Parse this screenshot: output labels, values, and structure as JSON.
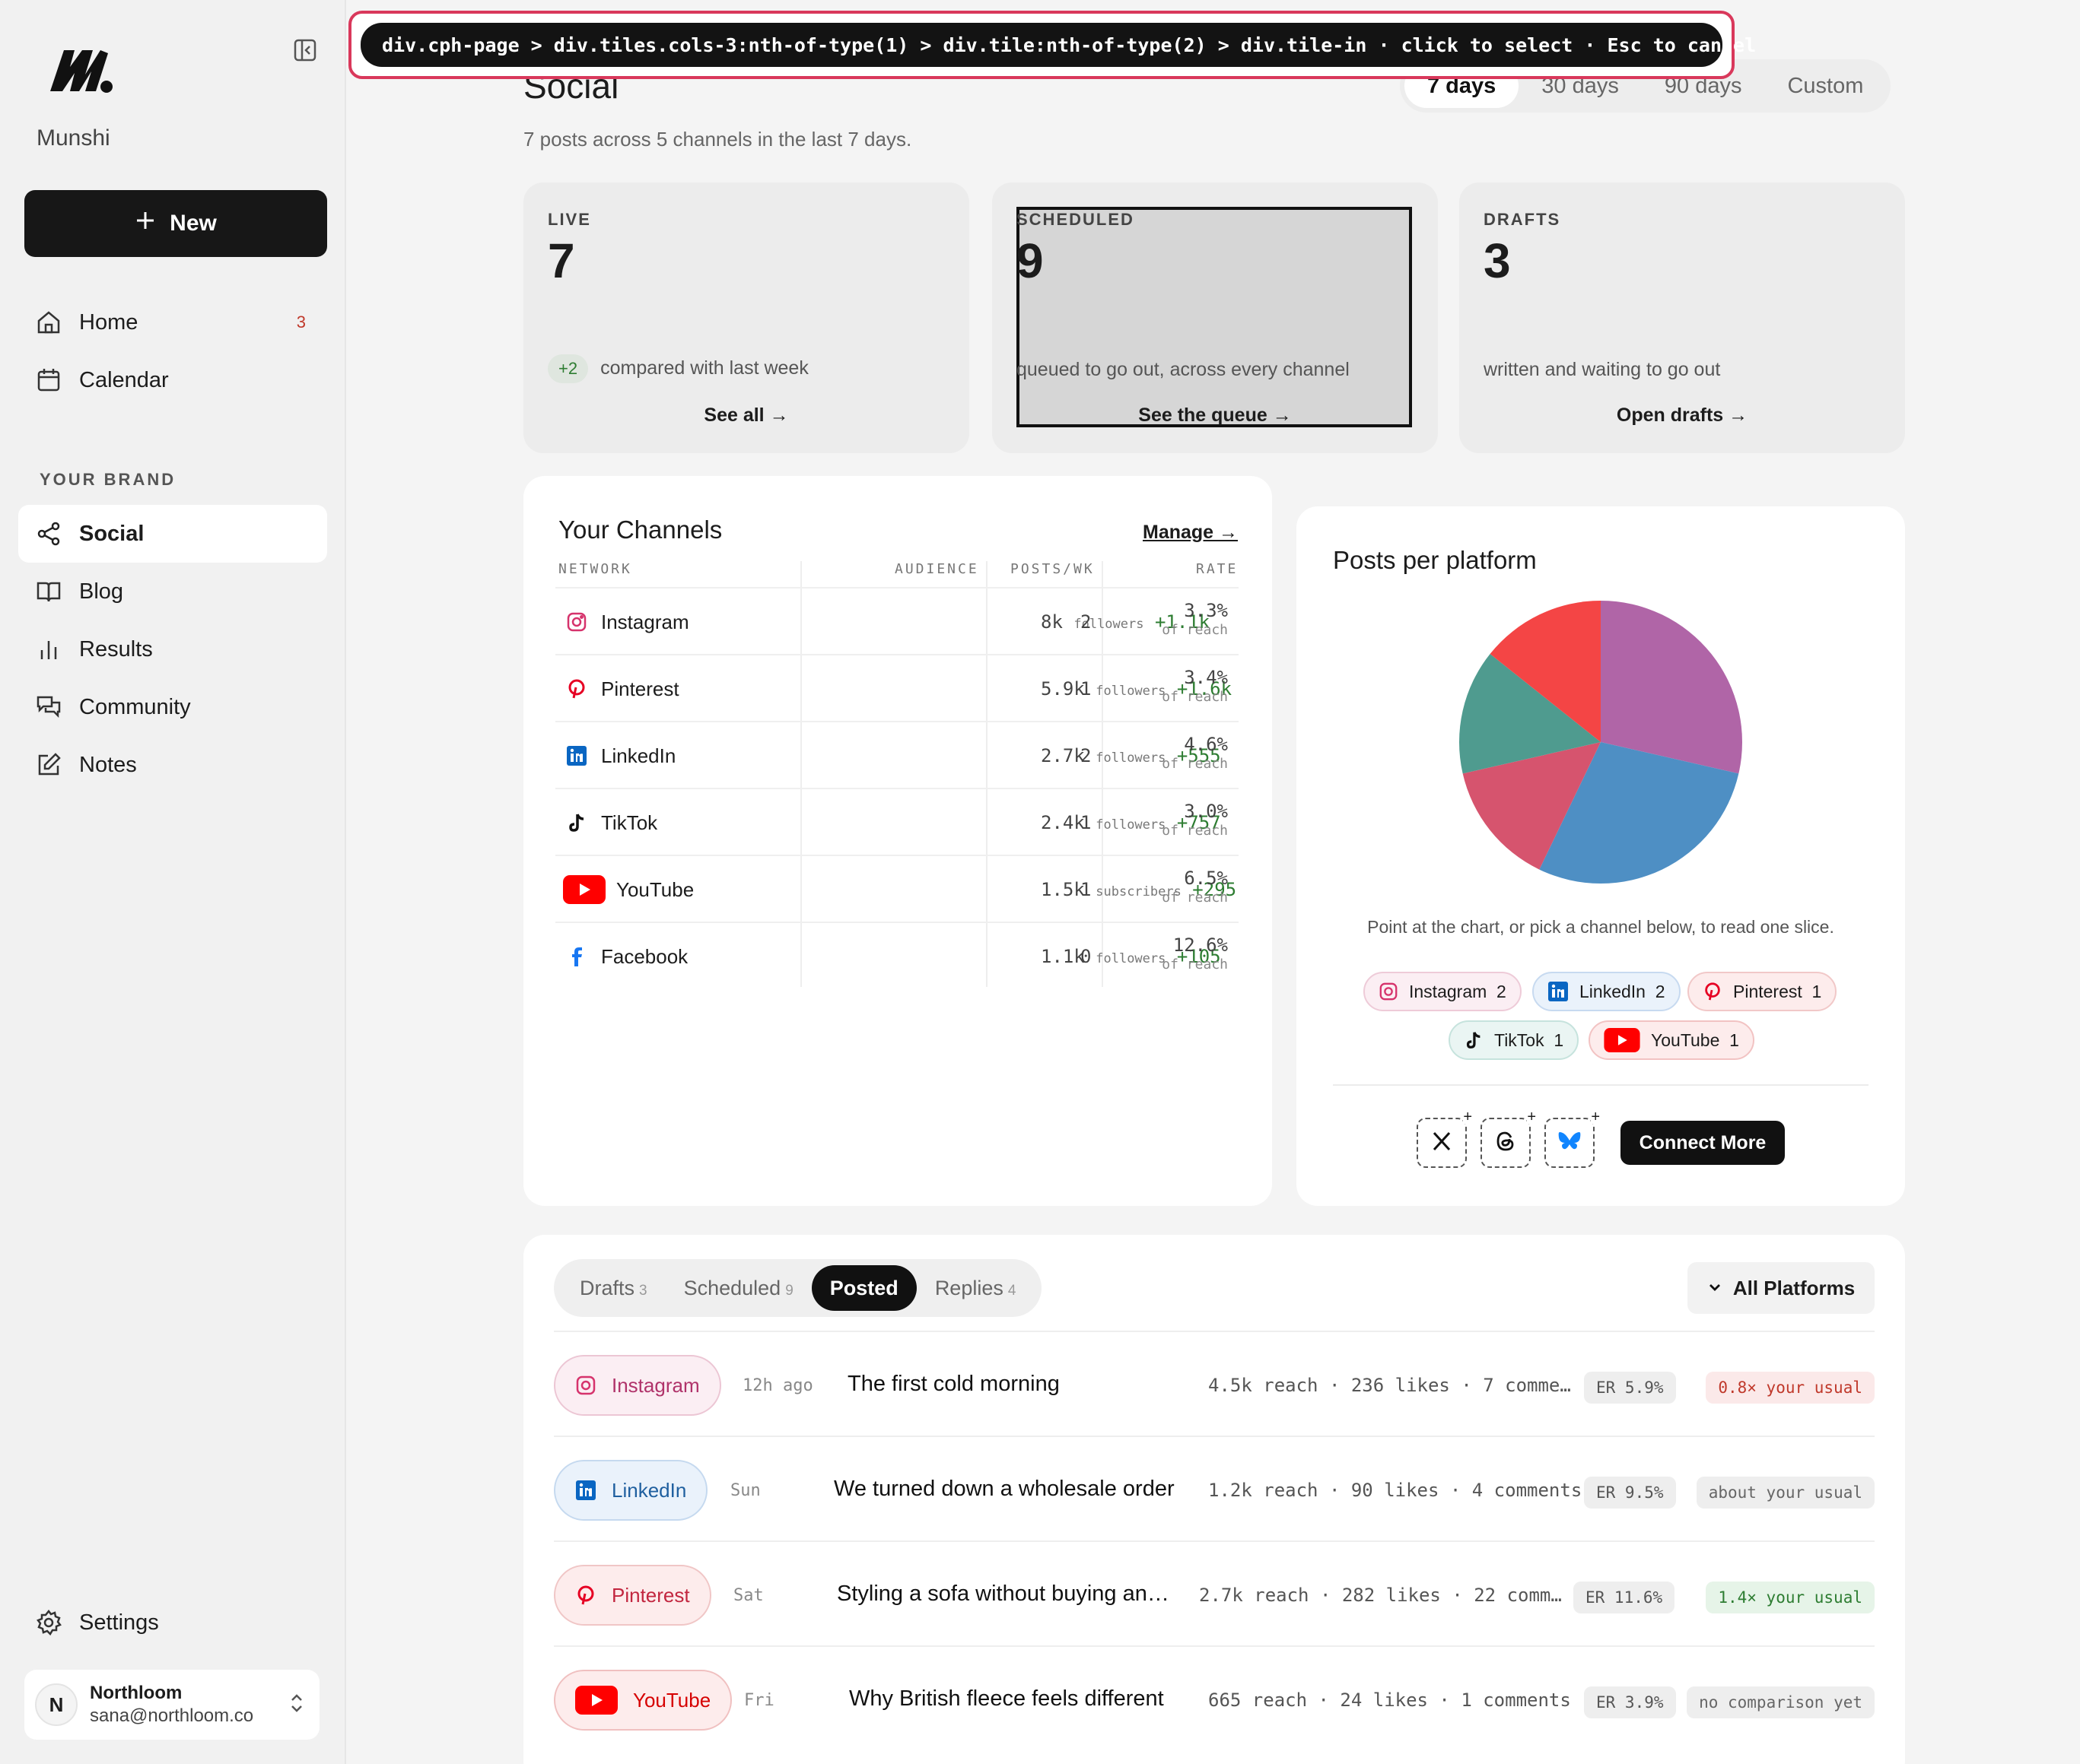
{
  "sidebar": {
    "brand": "Munshi",
    "new_label": "New",
    "nav": [
      {
        "label": "Home",
        "count": "3"
      },
      {
        "label": "Calendar"
      }
    ],
    "section_label": "YOUR BRAND",
    "brand_nav": [
      {
        "label": "Social",
        "active": true
      },
      {
        "label": "Blog"
      },
      {
        "label": "Results"
      },
      {
        "label": "Community"
      },
      {
        "label": "Notes"
      }
    ],
    "settings_label": "Settings",
    "account": {
      "initial": "N",
      "name": "Northloom",
      "email": "sana@northloom.co"
    }
  },
  "inspector": {
    "path": "div.cph-page > div.tiles.cols-3:nth-of-type(1) > div.tile:nth-of-type(2) > div.tile-in · click to select · Esc to cancel"
  },
  "header": {
    "title": "Social",
    "subtitle": "7 posts across 5 channels in the last 7 days.",
    "ranges": [
      "7 days",
      "30 days",
      "90 days",
      "Custom"
    ],
    "active_range": "7 days"
  },
  "tiles": [
    {
      "label": "LIVE",
      "value": "7",
      "delta": "+2",
      "note": "compared with last week",
      "link": "See all →"
    },
    {
      "label": "SCHEDULED",
      "value": "9",
      "note": "queued to go out, across every channel",
      "link": "See the queue →"
    },
    {
      "label": "DRAFTS",
      "value": "3",
      "note": "written and waiting to go out",
      "link": "Open drafts →"
    }
  ],
  "channels": {
    "title": "Your Channels",
    "manage": "Manage →",
    "headers": {
      "network": "NETWORK",
      "audience": "AUDIENCE",
      "posts": "POSTS/WK",
      "rate": "RATE"
    },
    "rows": [
      {
        "network": "Instagram",
        "audience": "8k",
        "unit": "followers",
        "growth": "+1.1k",
        "posts": "2",
        "rate": "3.3%",
        "rate_note": "of reach"
      },
      {
        "network": "Pinterest",
        "audience": "5.9k",
        "unit": "followers",
        "growth": "+1.6k",
        "posts": "1",
        "rate": "3.4%",
        "rate_note": "of reach"
      },
      {
        "network": "LinkedIn",
        "audience": "2.7k",
        "unit": "followers",
        "growth": "+555",
        "posts": "2",
        "rate": "4.6%",
        "rate_note": "of reach"
      },
      {
        "network": "TikTok",
        "audience": "2.4k",
        "unit": "followers",
        "growth": "+757",
        "posts": "1",
        "rate": "3.0%",
        "rate_note": "of reach"
      },
      {
        "network": "YouTube",
        "audience": "1.5k",
        "unit": "subscribers",
        "growth": "+295",
        "posts": "1",
        "rate": "6.5%",
        "rate_note": "of reach"
      },
      {
        "network": "Facebook",
        "audience": "1.1k",
        "unit": "followers",
        "growth": "+105",
        "posts": "0",
        "rate": "12.6%",
        "rate_note": "of reach"
      }
    ]
  },
  "platforms_card": {
    "title": "Posts per platform",
    "note": "Point at the chart, or pick a channel below, to read one slice.",
    "chips": [
      {
        "name": "Instagram",
        "count": "2"
      },
      {
        "name": "LinkedIn",
        "count": "2"
      },
      {
        "name": "Pinterest",
        "count": "1"
      },
      {
        "name": "TikTok",
        "count": "1"
      },
      {
        "name": "YouTube",
        "count": "1"
      }
    ],
    "connect_label": "Connect More"
  },
  "chart_data": {
    "type": "pie",
    "categories": [
      "Instagram",
      "LinkedIn",
      "Pinterest",
      "TikTok",
      "YouTube"
    ],
    "values": [
      2,
      2,
      1,
      1,
      1
    ],
    "colors": [
      "#b065a7",
      "#4e8fc4",
      "#d6546e",
      "#4f9b8f",
      "#f44545"
    ]
  },
  "posts": {
    "tabs": [
      {
        "label": "Drafts",
        "count": "3"
      },
      {
        "label": "Scheduled",
        "count": "9"
      },
      {
        "label": "Posted",
        "count": ""
      },
      {
        "label": "Replies",
        "count": "4"
      }
    ],
    "active_tab": "Posted",
    "filter_label": "All Platforms",
    "rows": [
      {
        "platform": "Instagram",
        "when": "12h ago",
        "title": "The first cold morning",
        "stats": "4.5k reach · 236 likes · 7 comme…",
        "er": "ER 5.9%",
        "usual": "0.8× your usual"
      },
      {
        "platform": "LinkedIn",
        "when": "Sun",
        "title": "We turned down a wholesale order",
        "stats": "1.2k reach · 90 likes · 4 comments",
        "er": "ER 9.5%",
        "usual": "about your usual"
      },
      {
        "platform": "Pinterest",
        "when": "Sat",
        "title": "Styling a sofa without buying an…",
        "stats": "2.7k reach · 282 likes · 22 comm…",
        "er": "ER 11.6%",
        "usual": "1.4× your usual"
      },
      {
        "platform": "YouTube",
        "when": "Fri",
        "title": "Why British fleece feels different",
        "stats": "665 reach · 24 likes · 1 comments",
        "er": "ER 3.9%",
        "usual": "no comparison yet"
      }
    ]
  }
}
